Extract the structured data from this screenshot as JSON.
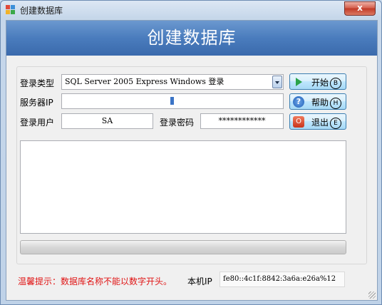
{
  "window": {
    "title": "创建数据库",
    "close_label": "x"
  },
  "banner": {
    "heading": "创建数据库"
  },
  "form": {
    "login_type_label": "登录类型",
    "login_type_value": "SQL Server 2005 Express Windows 登录",
    "server_ip_label": "服务器IP",
    "server_ip_value": "",
    "user_label": "登录用户",
    "user_value": "SA",
    "password_label": "登录密码",
    "password_value": "************"
  },
  "buttons": {
    "start_label": "开始",
    "start_key": "B",
    "help_label": "帮助",
    "help_key": "H",
    "exit_label": "退出",
    "exit_key": "E",
    "help_icon_glyph": "?",
    "exit_icon_glyph": "O"
  },
  "log": {
    "text": ""
  },
  "progress": {
    "value_percent": 0
  },
  "footer": {
    "hint": "温馨提示：数据库名称不能以数字开头。",
    "local_ip_label": "本机IP",
    "local_ip_value": "fe80::4c1f:8842:3a6a:e26a%12"
  },
  "colors": {
    "hint_text": "#e01414",
    "banner": "#4a7cbd"
  }
}
